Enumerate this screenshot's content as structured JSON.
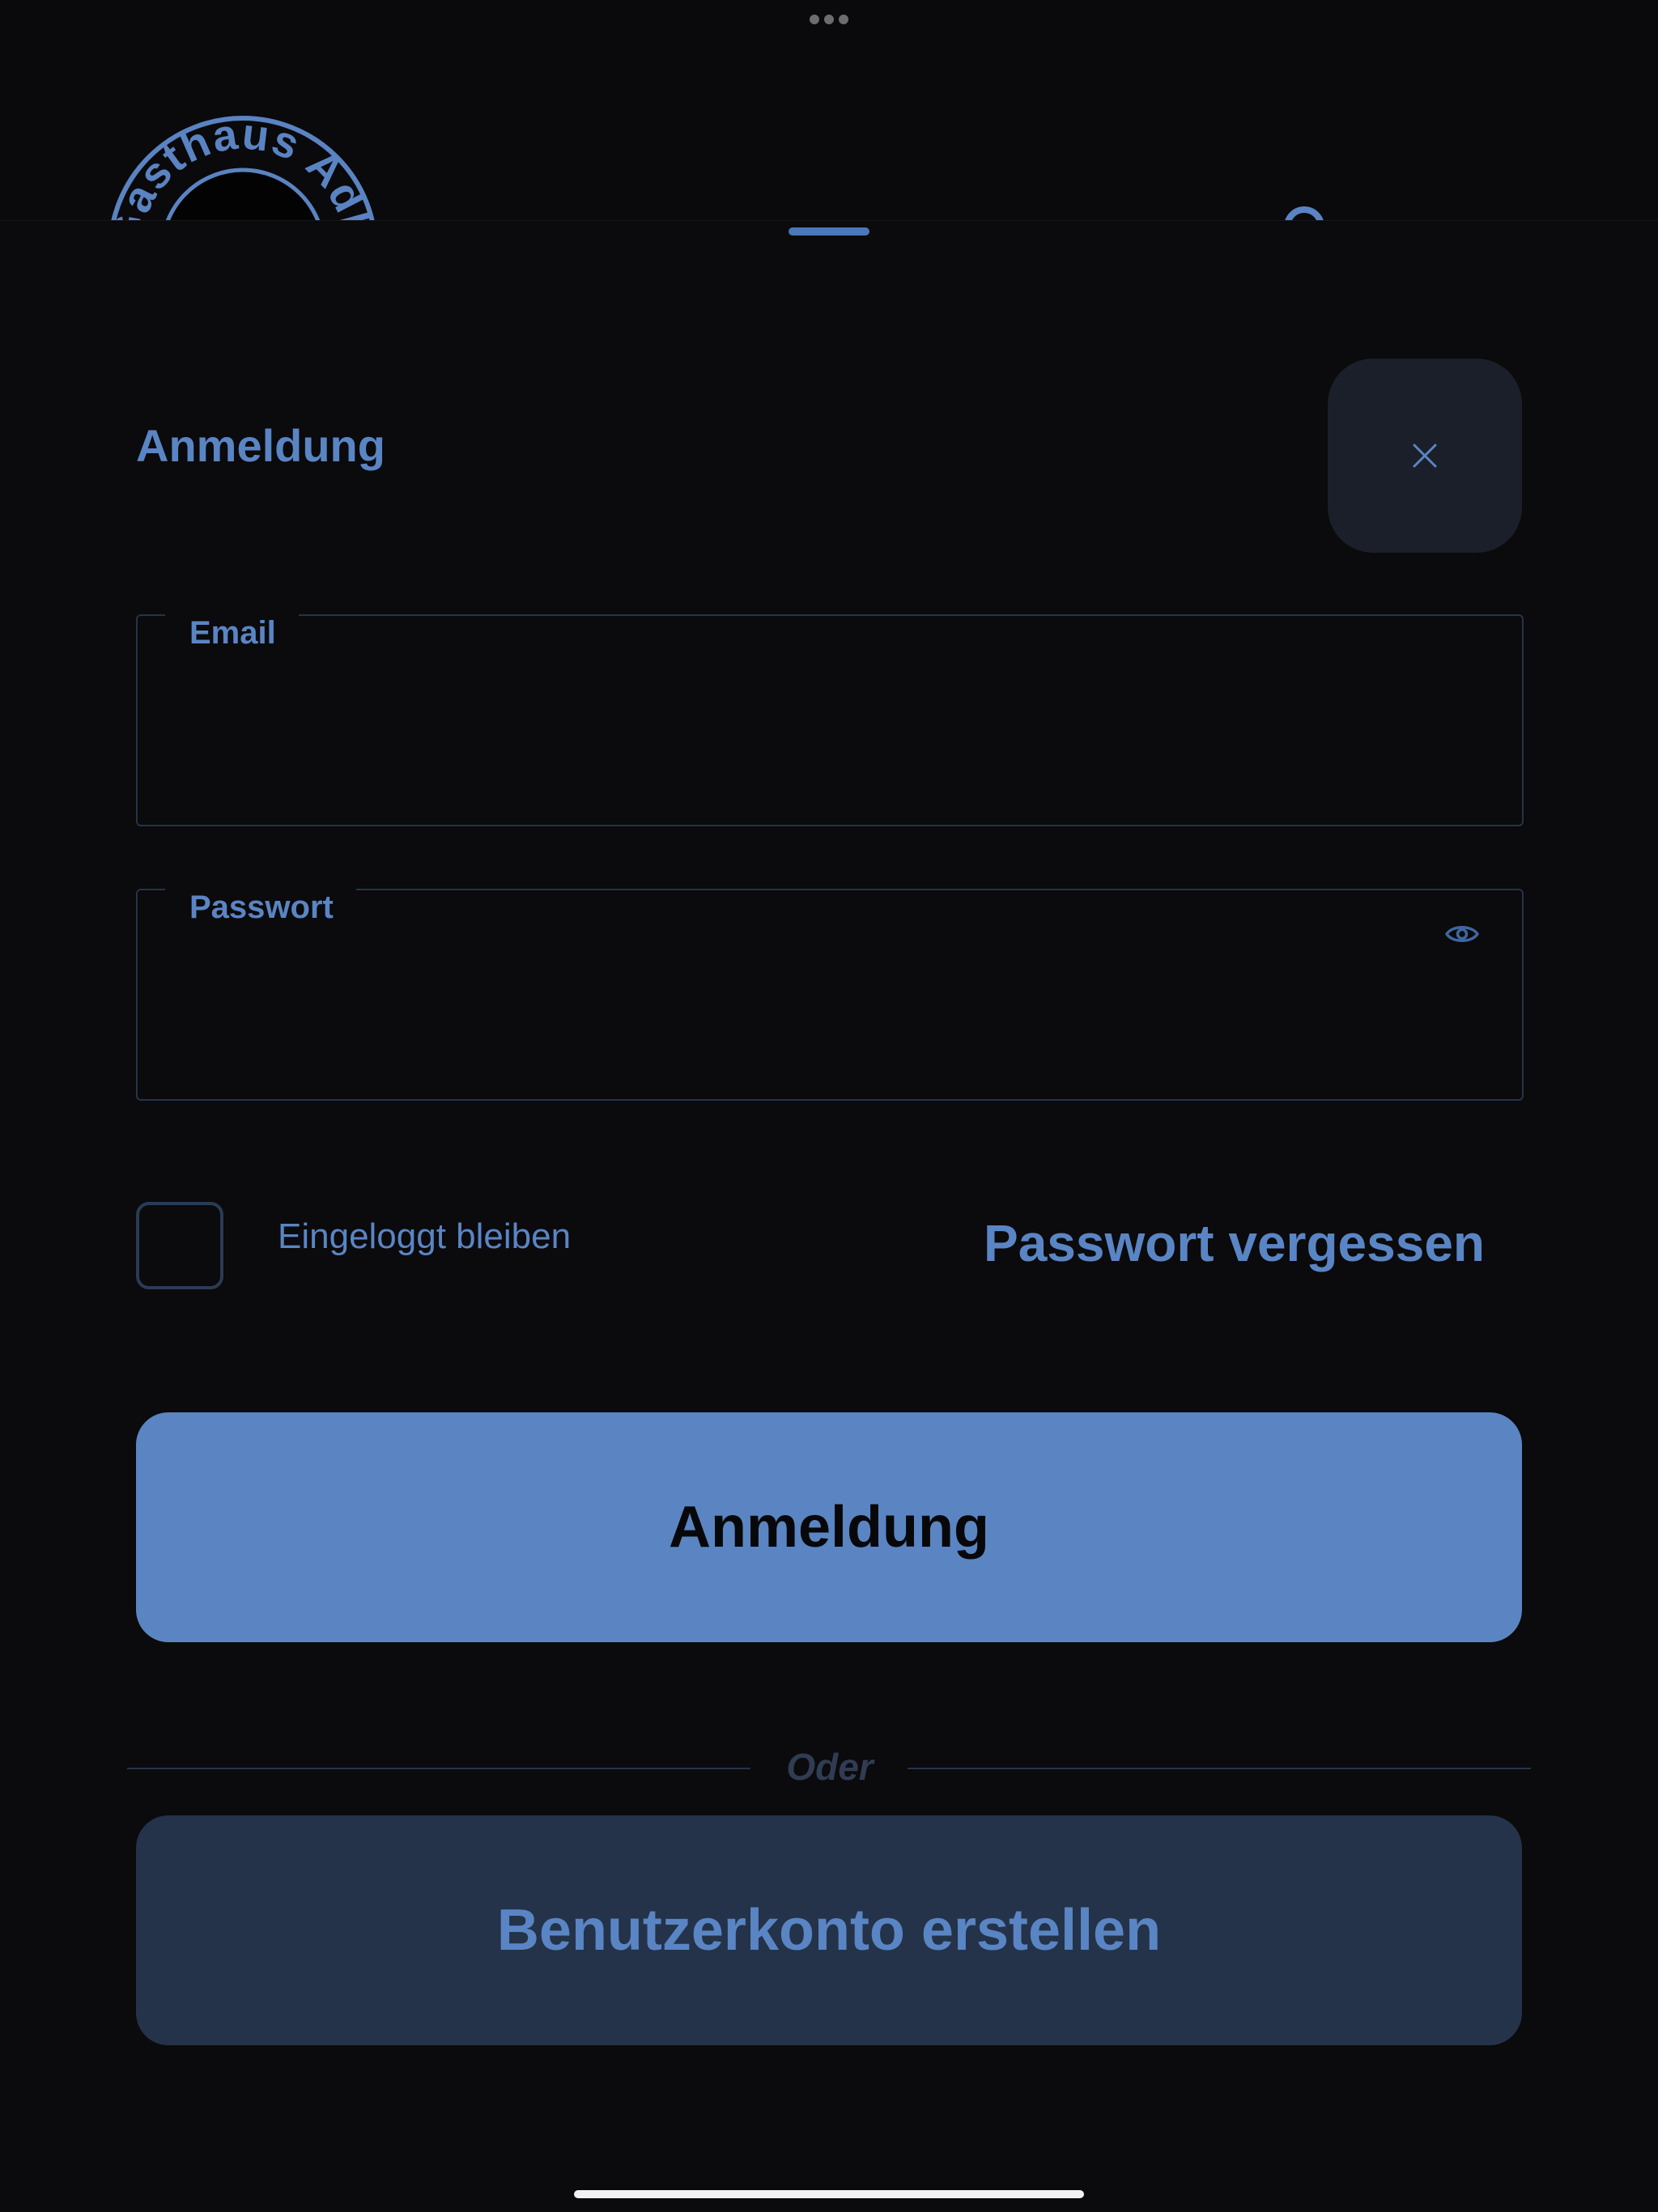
{
  "logo": {
    "text": "Gasthaus Adler"
  },
  "sheet": {
    "title": "Anmeldung",
    "close_icon": "close-icon"
  },
  "form": {
    "email": {
      "label": "Email",
      "value": ""
    },
    "password": {
      "label": "Passwort",
      "value": "",
      "toggle_icon": "eye-icon"
    },
    "remember": {
      "label": "Eingeloggt bleiben",
      "checked": false
    },
    "forgot_label": "Passwort vergessen",
    "submit_label": "Anmeldung",
    "divider_label": "Oder",
    "register_label": "Benutzerkonto erstellen"
  },
  "colors": {
    "background": "#0b0a0c",
    "accent": "#5a85c2",
    "secondary_button": "#243349",
    "close_button": "#1b1f29",
    "field_border": "#26334a"
  }
}
